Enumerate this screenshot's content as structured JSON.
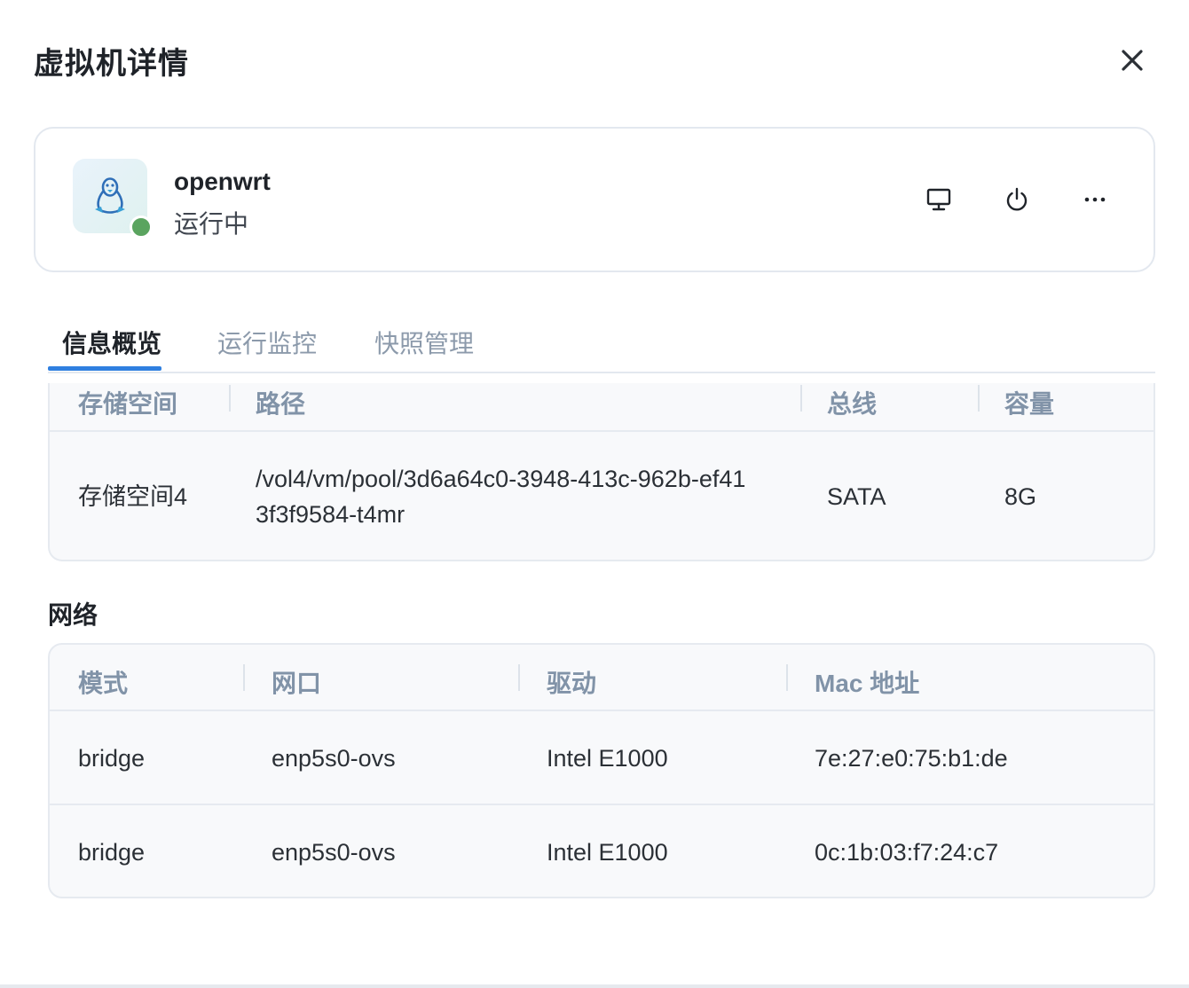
{
  "dialog": {
    "title": "虚拟机详情",
    "close_icon": "close-icon"
  },
  "vm": {
    "name": "openwrt",
    "status": "运行中",
    "status_color": "#5aa45f",
    "os_icon": "linux-penguin-icon",
    "actions": [
      {
        "name": "console",
        "icon": "monitor-icon"
      },
      {
        "name": "power",
        "icon": "power-icon"
      },
      {
        "name": "more",
        "icon": "more-horizontal-icon"
      }
    ]
  },
  "tabs": [
    {
      "label": "信息概览",
      "active": true
    },
    {
      "label": "运行监控",
      "active": false
    },
    {
      "label": "快照管理",
      "active": false
    }
  ],
  "storage": {
    "columns": [
      "存储空间",
      "路径",
      "总线",
      "容量"
    ],
    "rows": [
      {
        "space": "存储空间4",
        "path": "/vol4/vm/pool/3d6a64c0-3948-413c-962b-ef413f3f9584-t4mr",
        "bus": "SATA",
        "capacity": "8G"
      }
    ]
  },
  "network": {
    "title": "网络",
    "columns": [
      "模式",
      "网口",
      "驱动",
      "Mac 地址"
    ],
    "rows": [
      {
        "mode": "bridge",
        "port": "enp5s0-ovs",
        "driver": "Intel E1000",
        "mac": "7e:27:e0:75:b1:de"
      },
      {
        "mode": "bridge",
        "port": "enp5s0-ovs",
        "driver": "Intel E1000",
        "mac": "0c:1b:03:f7:24:c7"
      }
    ]
  },
  "colors": {
    "accent": "#2f7fe0",
    "header_text": "#8193a8",
    "tab_inactive": "#8c9aab"
  }
}
